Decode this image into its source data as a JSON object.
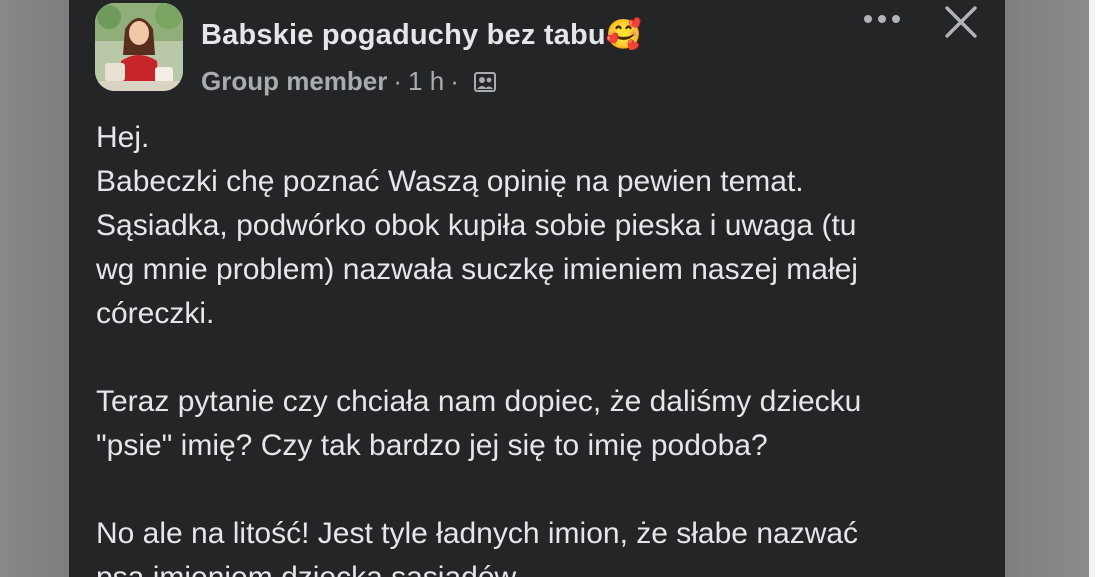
{
  "post": {
    "group_name": "Babskie pogaduchy bez tabu",
    "group_emoji": "🥰",
    "author_role": "Group member",
    "separator": "·",
    "time": "1 h",
    "icons": {
      "more": "more-horizontal-icon",
      "close": "close-icon",
      "audience": "group-audience-icon"
    },
    "paragraphs": [
      {
        "lines": [
          "Hej.",
          "Babeczki chę poznać Waszą opinię na pewien temat.",
          "Sąsiadka, podwórko obok kupiła sobie pieska i uwaga (tu",
          "wg mnie problem) nazwała suczkę imieniem naszej małej",
          "córeczki."
        ]
      },
      {
        "lines": [
          "Teraz pytanie czy chciała nam dopiec, że daliśmy dziecku",
          "\"psie\" imię? Czy tak bardzo jej się to imię podoba?"
        ]
      },
      {
        "lines": [
          "No ale na litość! Jest tyle ładnych imion, że słabe nazwać",
          "psa imieniem dziecka sąsiadów."
        ]
      }
    ]
  },
  "colors": {
    "card_bg": "#242526",
    "text_primary": "#e4e6eb",
    "text_secondary": "#a8abaf"
  }
}
